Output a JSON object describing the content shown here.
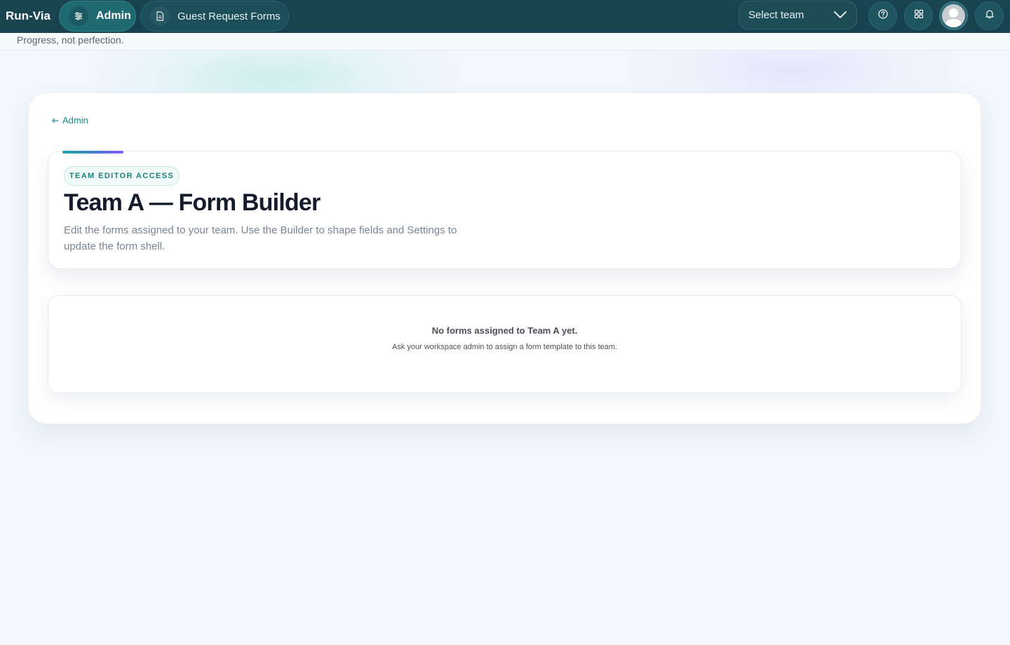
{
  "app": {
    "brand": "Run-Via",
    "tagline": "Progress, not perfection."
  },
  "nav": {
    "admin_label": "Admin",
    "forms_label": "Guest Request Forms",
    "team_select": "Select team"
  },
  "icons": {
    "admin": "sliders-icon",
    "forms": "document-icon",
    "chevron": "chevron-down-icon",
    "help": "help-circle-icon",
    "apps": "grid-icon",
    "avatar": "user-avatar",
    "notifications": "bell-icon"
  },
  "colors": {
    "topbar": "#1a4450",
    "accent": "#1e8c8a",
    "background": "#f1f7fc"
  },
  "main": {
    "back_label": "Admin",
    "badge": "TEAM EDITOR ACCESS",
    "title": "Team A — Form Builder",
    "description": "Edit the forms assigned to your team. Use the Builder to shape fields and Settings to update the form shell."
  },
  "empty_state": {
    "title": "No forms assigned to Team A yet.",
    "subtitle": "Ask your workspace admin to assign a form template to this team."
  }
}
